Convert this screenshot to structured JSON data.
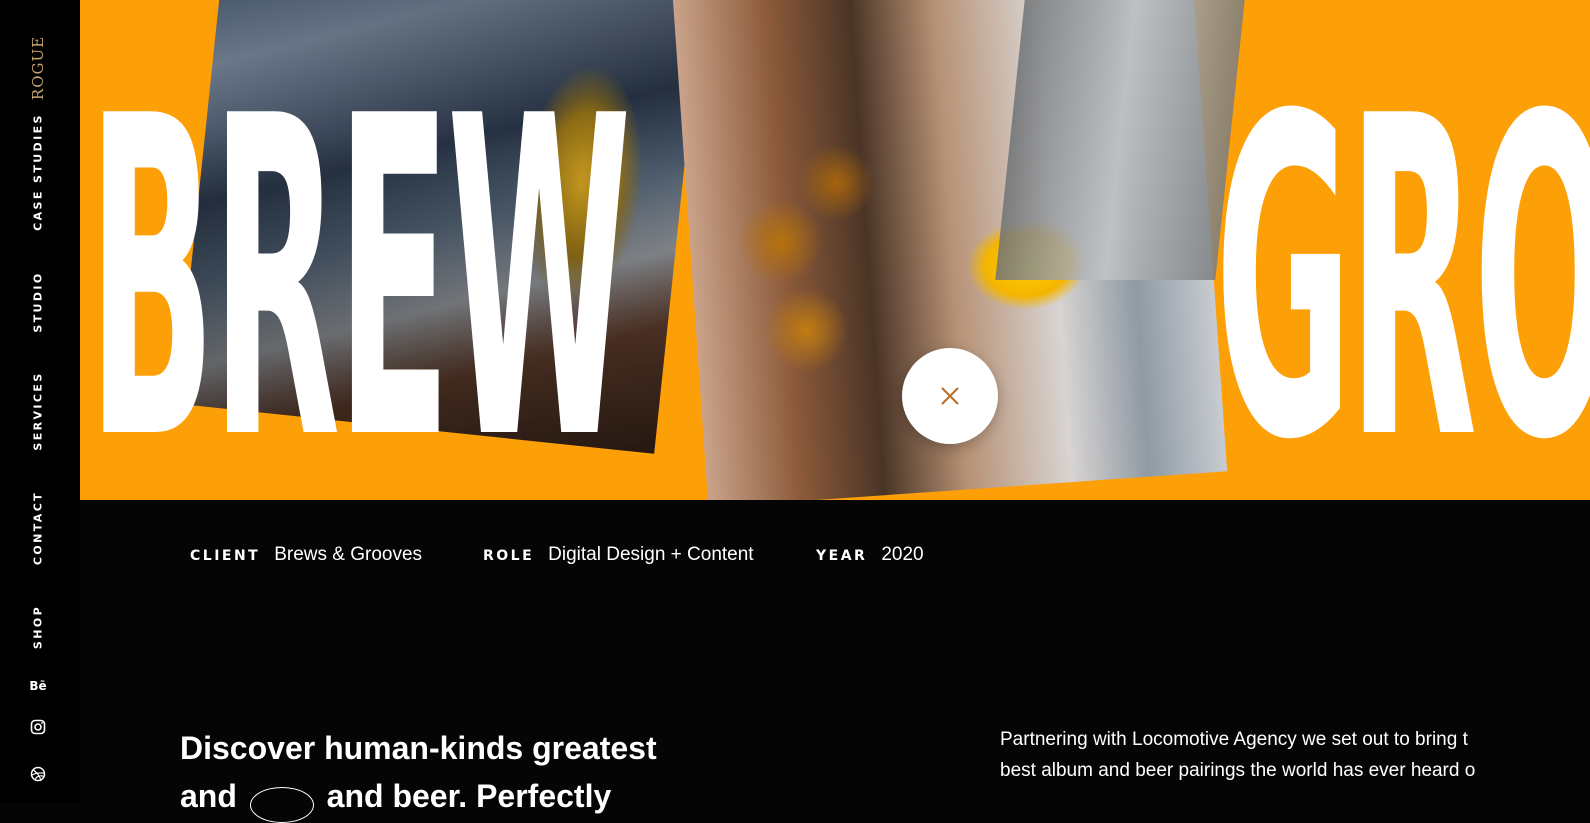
{
  "sidebar": {
    "logo": "ROGUE",
    "nav": [
      "CASE STUDIES",
      "STUDIO",
      "SERVICES",
      "CONTACT",
      "SHOP"
    ],
    "social_icons": [
      "behance-icon",
      "instagram-icon",
      "dribbble-icon"
    ],
    "behance_glyph": "Bē"
  },
  "hero": {
    "word_left": "BREW",
    "word_right": "GRO",
    "accent_color": "#fd9f06",
    "close_icon": "close-icon"
  },
  "meta": {
    "client_label": "CLIENT",
    "client_value": "Brews & Grooves",
    "role_label": "ROLE",
    "role_value": "Digital Design + Content",
    "year_label": "YEAR",
    "year_value": "2020"
  },
  "intro": {
    "headline_line1": "Discover human-kinds greatest",
    "headline_line2_start": "and",
    "headline_line2_end": "and beer. Perfectly",
    "paragraph_line1": "Partnering with Locomotive Agency we set out to bring t",
    "paragraph_line2": "best album and beer pairings the world has ever heard o"
  }
}
